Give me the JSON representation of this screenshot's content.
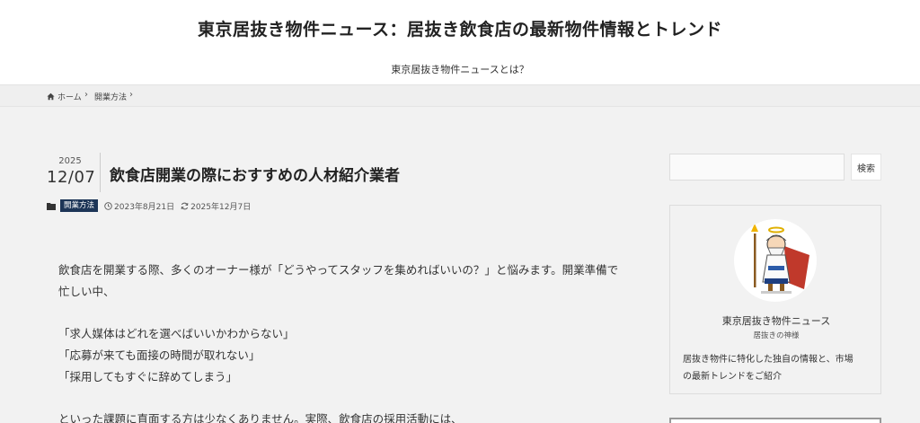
{
  "header": {
    "site_title": "東京居抜き物件ニュース：居抜き飲食店の最新物件情報とトレンド",
    "nav_link": "東京居抜き物件ニュースとは？"
  },
  "breadcrumb": {
    "home": "ホーム",
    "category": "開業方法"
  },
  "post": {
    "year": "2025",
    "month_day": "12/07",
    "title": "飲食店開業の際におすすめの人材紹介業者",
    "category": "開業方法",
    "published": "2023年8月21日",
    "updated": "2025年12月7日"
  },
  "content": {
    "intro_line1": "飲食店を開業する際、多くのオーナー様が「どうやってスタッフを集めればいいの？」と悩みます。開業準備で",
    "intro_line2": "忙しい中、",
    "quote1": "「求人媒体はどれを選べばいいかわからない」",
    "quote2": "「応募が来ても面接の時間が取れない」",
    "quote3": "「採用してもすぐに辞めてしまう」",
    "after_quotes": "といった課題に直面する方は少なくありません。実際、飲食店の採用活動には、"
  },
  "sidebar": {
    "search_button": "検索",
    "search_placeholder": "",
    "profile_name": "東京居抜き物件ニュース",
    "profile_subtitle": "居抜きの神様",
    "profile_desc_line1": "居抜き物件に特化した独自の情報と、市場",
    "profile_desc_line2": "の最新トレンドをご紹介"
  },
  "icons": {
    "home": "home-icon",
    "folder": "folder-icon",
    "clock": "clock-icon",
    "refresh": "refresh-icon",
    "chevron": "chevron-right-icon"
  },
  "colors": {
    "category_badge": "#1d3557",
    "page_background": "#f2f2f2",
    "header_background": "#ffffff"
  }
}
